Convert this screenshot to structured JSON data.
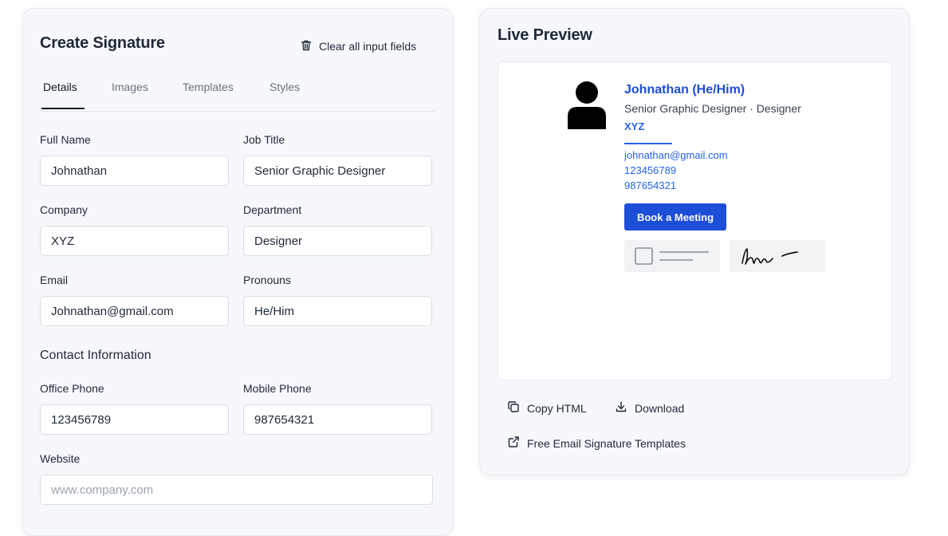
{
  "editor": {
    "title": "Create Signature",
    "clear_label": "Clear all input fields",
    "tabs": [
      {
        "label": "Details"
      },
      {
        "label": "Images"
      },
      {
        "label": "Templates"
      },
      {
        "label": "Styles"
      }
    ],
    "fields": {
      "full_name": {
        "label": "Full Name",
        "value": "Johnathan"
      },
      "job_title": {
        "label": "Job Title",
        "value": "Senior Graphic Designer"
      },
      "company": {
        "label": "Company",
        "value": "XYZ"
      },
      "department": {
        "label": "Department",
        "value": "Designer"
      },
      "email": {
        "label": "Email",
        "value": "Johnathan@gmail.com"
      },
      "pronouns": {
        "label": "Pronouns",
        "value": "He/Him"
      },
      "office_phone": {
        "label": "Office Phone",
        "value": "123456789"
      },
      "mobile_phone": {
        "label": "Mobile Phone",
        "value": "987654321"
      },
      "website": {
        "label": "Website",
        "value": "",
        "placeholder": "www.company.com"
      }
    },
    "contact_section": "Contact Information"
  },
  "preview": {
    "title": "Live Preview",
    "name": "Johnathan (He/Him)",
    "role": "Senior Graphic Designer · Designer",
    "company": "XYZ",
    "email": "johnathan@gmail.com",
    "phone1": "123456789",
    "phone2": "987654321",
    "book_label": "Book a Meeting",
    "copy_label": "Copy HTML",
    "download_label": "Download",
    "templates_label": "Free Email Signature Templates"
  },
  "colors": {
    "accent": "#1d4ed8",
    "panel_bg": "#f6f8fb"
  }
}
